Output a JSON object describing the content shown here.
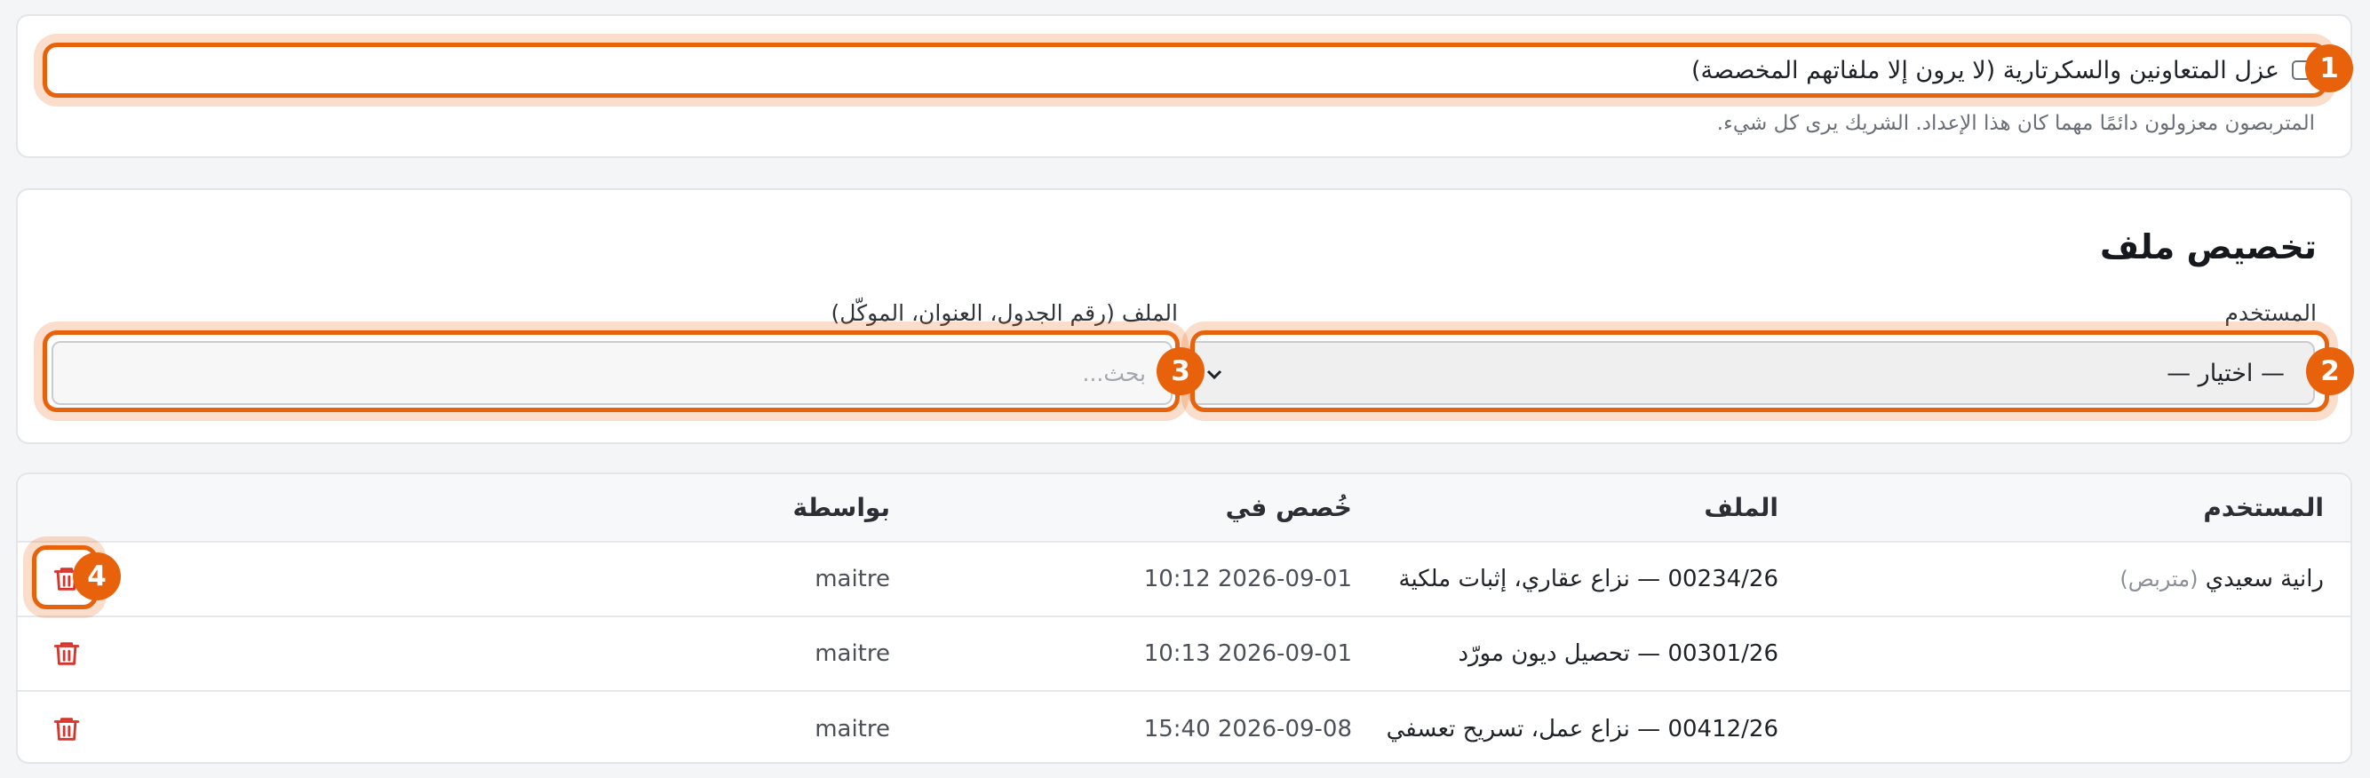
{
  "isolation": {
    "label": "عزل المتعاونين والسكرتارية (لا يرون إلا ملفاتهم المخصصة)",
    "checked": false,
    "help": "المتربصون معزولون دائمًا مهما كان هذا الإعداد. الشريك يرى كل شيء."
  },
  "assign": {
    "title": "تخصيص ملف",
    "user_label": "المستخدم",
    "user_select_value": "— اختيار —",
    "file_label": "الملف (رقم الجدول، العنوان، الموكّل)",
    "file_placeholder": "بحث..."
  },
  "table": {
    "headers": {
      "user": "المستخدم",
      "file": "الملف",
      "assigned_at": "خُصص في",
      "by": "بواسطة"
    },
    "rows": [
      {
        "user": "رانية سعيدي",
        "role": "(متربص)",
        "file": "00234/26 — نزاع عقاري، إثبات ملكية",
        "assigned_at": "2026-09-01 10:12",
        "by": "maitre"
      },
      {
        "user": "",
        "role": "",
        "file": "00301/26 — تحصيل ديون مورّد",
        "assigned_at": "2026-09-01 10:13",
        "by": "maitre"
      },
      {
        "user": "",
        "role": "",
        "file": "00412/26 — نزاع عمل، تسريح تعسفي",
        "assigned_at": "2026-09-08 15:40",
        "by": "maitre"
      }
    ]
  },
  "annotations": [
    "1",
    "2",
    "3",
    "4"
  ],
  "colors": {
    "accent": "#e8620c",
    "danger": "#d9342b"
  },
  "icons": {
    "delete": "trash-icon",
    "dropdown": "chevron-down-icon"
  }
}
